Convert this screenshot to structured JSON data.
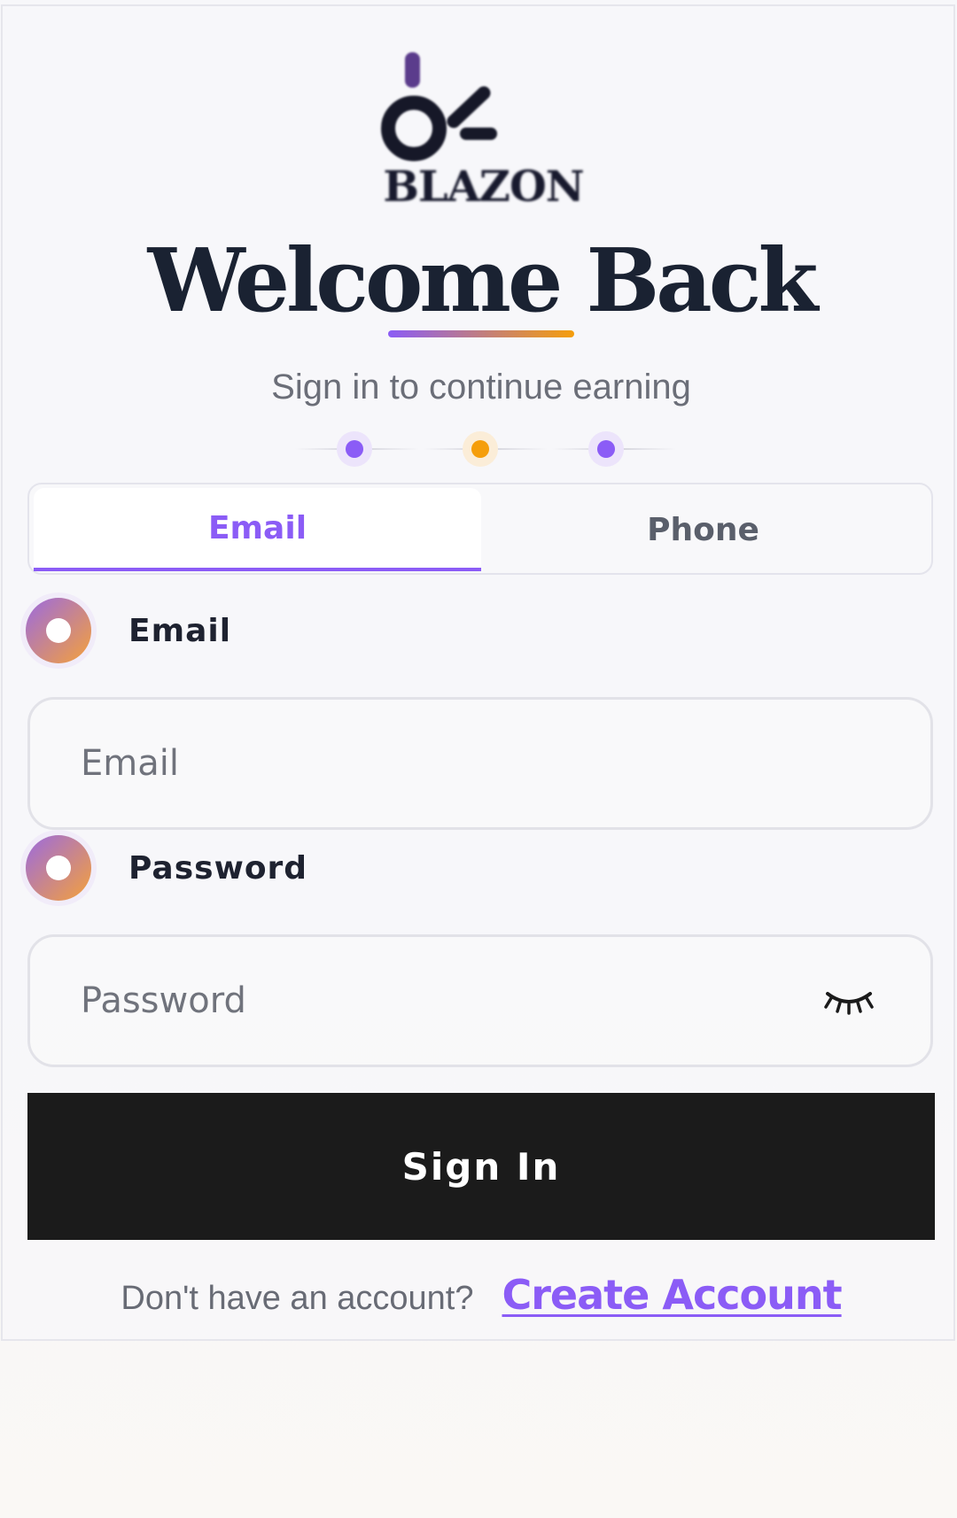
{
  "brand": {
    "name": "BLAZON",
    "logo_icon": "blazon-logo-icon",
    "colors": {
      "accent_purple": "#8b5cf6",
      "accent_orange": "#f59e0b",
      "button_dark": "#1b1b1b",
      "heading": "#1a2232"
    }
  },
  "header": {
    "title": "Welcome Back",
    "subtitle": "Sign in to continue earning"
  },
  "tabs": [
    {
      "label": "Email",
      "active": true
    },
    {
      "label": "Phone",
      "active": false
    }
  ],
  "form": {
    "email": {
      "label": "Email",
      "placeholder": "Email",
      "value": ""
    },
    "password": {
      "label": "Password",
      "placeholder": "Password",
      "value": "",
      "toggle_icon": "eye-closed-icon"
    },
    "submit_label": "Sign In"
  },
  "footer": {
    "prompt": "Don't have an account?",
    "link_label": "Create Account"
  }
}
